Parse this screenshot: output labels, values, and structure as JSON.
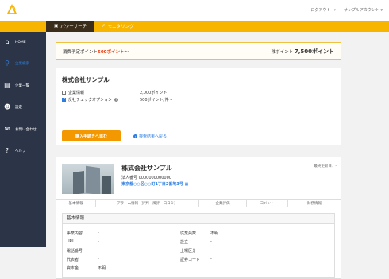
{
  "header": {
    "logout_label": "ログアウト",
    "account_label": "サンプルアカウント"
  },
  "tabs": [
    {
      "label": "パワーサーチ",
      "icon": "briefcase-icon"
    },
    {
      "label": "モニタリング",
      "icon": "chart-icon"
    }
  ],
  "sidebar": {
    "items": [
      {
        "label": "HOME",
        "icon": "home-icon"
      },
      {
        "label": "企業検索",
        "icon": "search-icon"
      },
      {
        "label": "企業一覧",
        "icon": "document-icon"
      },
      {
        "label": "設定",
        "icon": "user-gear-icon"
      },
      {
        "label": "お問い合わせ",
        "icon": "mail-icon"
      },
      {
        "label": "ヘルプ",
        "icon": "question-icon"
      }
    ]
  },
  "points": {
    "scheduled_prefix": "消費予定ポイント",
    "scheduled_value": "500ポイント〜",
    "remaining_label": "残ポイント",
    "remaining_value": "7,500ポイント"
  },
  "purchase": {
    "company_name": "株式会社サンプル",
    "options": [
      {
        "label": "企業情報",
        "price": "2,000ポイント",
        "checked": false
      },
      {
        "label": "反社チェックオプション",
        "price": "500ポイント/件〜",
        "checked": true
      }
    ],
    "buy_button": "購入手続きへ進む",
    "back_link": "検索結果へ戻る"
  },
  "detail": {
    "company_name": "株式会社サンプル",
    "corp_number": "法人番号 0000000000000",
    "address": "東京都○○区○○町1丁目2番地3号",
    "updated_label": "最終更新日：-",
    "tabs": [
      "基本情報",
      "アラーム情報（評判・風評・口コミ）",
      "企業評価",
      "コメント",
      "財務情報"
    ],
    "basic_title": "基本情報",
    "left_fields": [
      {
        "label": "事業内容",
        "value": "-"
      },
      {
        "label": "URL",
        "value": "-"
      },
      {
        "label": "電話番号",
        "value": "-"
      },
      {
        "label": "代表者",
        "value": "-"
      },
      {
        "label": "資本金",
        "value": "不明"
      }
    ],
    "right_fields": [
      {
        "label": "従業員数",
        "value": "不明"
      },
      {
        "label": "設立",
        "value": "-"
      },
      {
        "label": "上場区分",
        "value": "-"
      },
      {
        "label": "証券コード",
        "value": "-"
      }
    ]
  },
  "colors": {
    "accent_orange": "#f7b500",
    "button_orange": "#f39800",
    "sidebar_bg": "#2c3547",
    "active_tab_bg": "#3a2e1a",
    "link_blue": "#2a7de1",
    "highlight_red": "#e8380d"
  }
}
